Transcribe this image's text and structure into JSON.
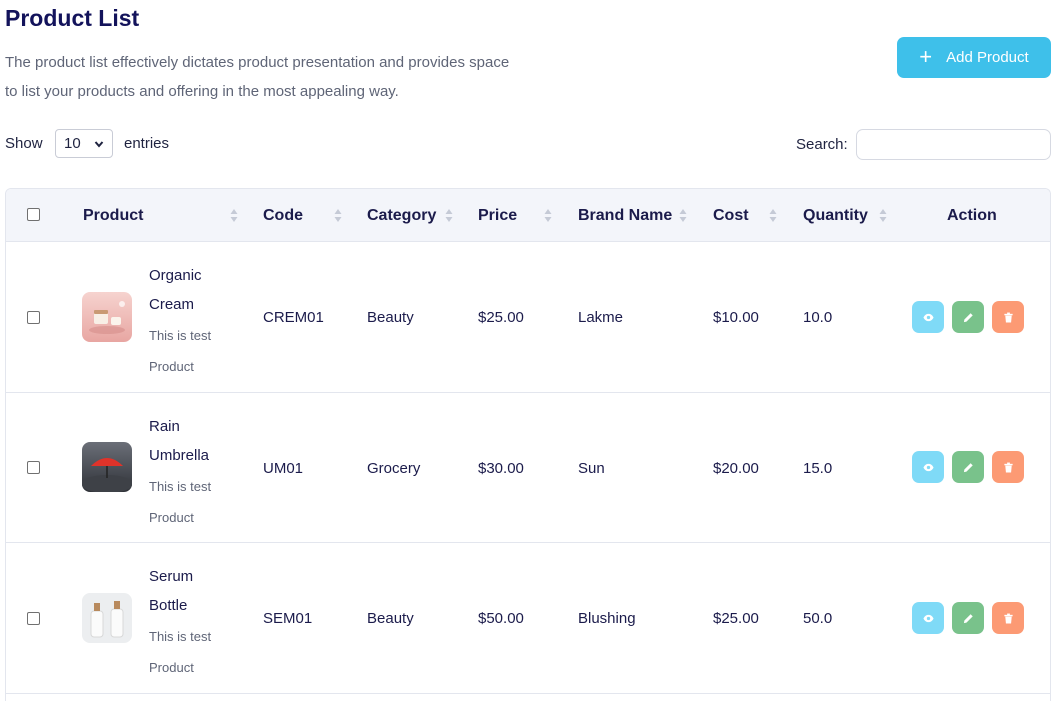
{
  "header": {
    "title": "Product List",
    "description_line1": "The product list effectively dictates product presentation and provides space",
    "description_line2": "to list your products and offering in the most appealing way.",
    "add_button_label": "Add Product"
  },
  "controls": {
    "show_label": "Show",
    "entries_value": "10",
    "entries_label": "entries",
    "search_label": "Search:",
    "search_value": ""
  },
  "table": {
    "columns": [
      "Product",
      "Code",
      "Category",
      "Price",
      "Brand Name",
      "Cost",
      "Quantity",
      "Action"
    ],
    "rows": [
      {
        "name_line1": "Organic",
        "name_line2": "Cream",
        "desc_line1": "This is test",
        "desc_line2": "Product",
        "code": "CREM01",
        "category": "Beauty",
        "price": "$25.00",
        "brand": "Lakme",
        "cost": "$10.00",
        "quantity": "10.0",
        "image": "cream-image"
      },
      {
        "name_line1": "Rain",
        "name_line2": "Umbrella",
        "desc_line1": "This is test",
        "desc_line2": "Product",
        "code": "UM01",
        "category": "Grocery",
        "price": "$30.00",
        "brand": "Sun",
        "cost": "$20.00",
        "quantity": "15.0",
        "image": "umbrella-image"
      },
      {
        "name_line1": "Serum",
        "name_line2": "Bottle",
        "desc_line1": "This is test",
        "desc_line2": "Product",
        "code": "SEM01",
        "category": "Beauty",
        "price": "$50.00",
        "brand": "Blushing",
        "cost": "$25.00",
        "quantity": "50.0",
        "image": "serum-bottle-image"
      }
    ]
  },
  "icons": {
    "add": "plus-icon",
    "select": "chevron-down-icon",
    "sort": "sort-icon",
    "view": "eye-icon",
    "edit": "pencil-icon",
    "delete": "trash-icon"
  },
  "colors": {
    "primary": "#3ec0ea",
    "view": "#7fdaf7",
    "edit": "#79c28b",
    "delete": "#fc9a74",
    "title": "#13135b"
  }
}
